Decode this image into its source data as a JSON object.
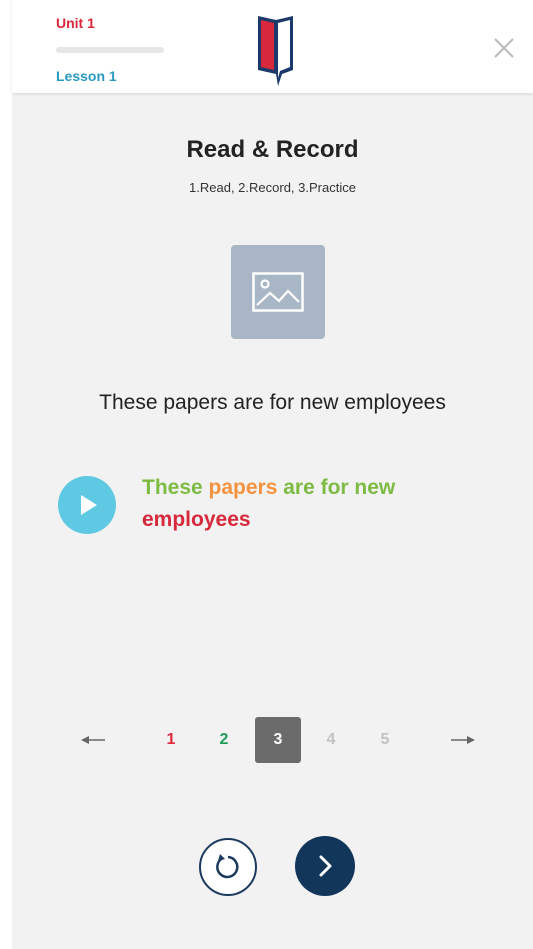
{
  "header": {
    "unit": "Unit 1",
    "lesson": "Lesson 1",
    "progress": 0.0,
    "brand_colors": {
      "red": "#d8283b",
      "blue": "#2a9ac0"
    }
  },
  "activity": {
    "title": "Read & Record",
    "steps": "1.Read, 2.Record, 3.Practice",
    "image_icon": "image-placeholder-icon"
  },
  "sentence": {
    "plain": "These papers are for new employees",
    "words": [
      {
        "text": "These ",
        "color": "#7dbb42"
      },
      {
        "text": "papers ",
        "color": "#f5923e"
      },
      {
        "text": "are for new ",
        "color": "#7dbb42"
      },
      {
        "text": "employees",
        "color": "#d8283b"
      }
    ]
  },
  "pager": {
    "pages": [
      {
        "label": "1",
        "color": "#e0283b"
      },
      {
        "label": "2",
        "color": "#1f9d55"
      },
      {
        "label": "3",
        "color": "#ffffff"
      },
      {
        "label": "4",
        "color": "#c2c2c2"
      },
      {
        "label": "5",
        "color": "#c2c2c2"
      }
    ],
    "current_page": 3
  },
  "controls": {
    "reload_icon": "reload-icon",
    "next_icon": "chevron-right-icon"
  }
}
